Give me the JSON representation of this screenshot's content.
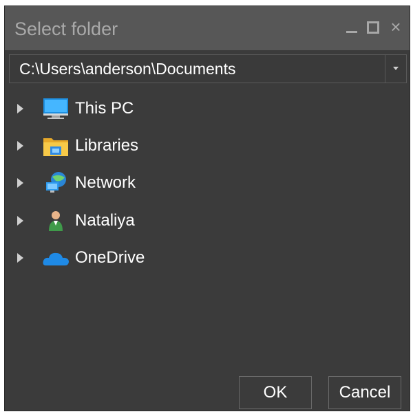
{
  "window": {
    "title": "Select folder",
    "controls": {
      "minimize": "minimize",
      "maximize": "maximize",
      "close": "×"
    }
  },
  "path": {
    "value": "C:\\Users\\anderson\\Documents"
  },
  "tree": {
    "items": [
      {
        "label": "This PC",
        "icon": "computer-icon"
      },
      {
        "label": "Libraries",
        "icon": "library-folder-icon"
      },
      {
        "label": "Network",
        "icon": "network-icon"
      },
      {
        "label": "Nataliya",
        "icon": "user-icon"
      },
      {
        "label": "OneDrive",
        "icon": "cloud-icon"
      }
    ]
  },
  "buttons": {
    "ok": "OK",
    "cancel": "Cancel"
  },
  "colors": {
    "background": "#3b3b3b",
    "titlebar": "#575757",
    "text": "#ffffff",
    "title_text": "#a9a9a9"
  }
}
